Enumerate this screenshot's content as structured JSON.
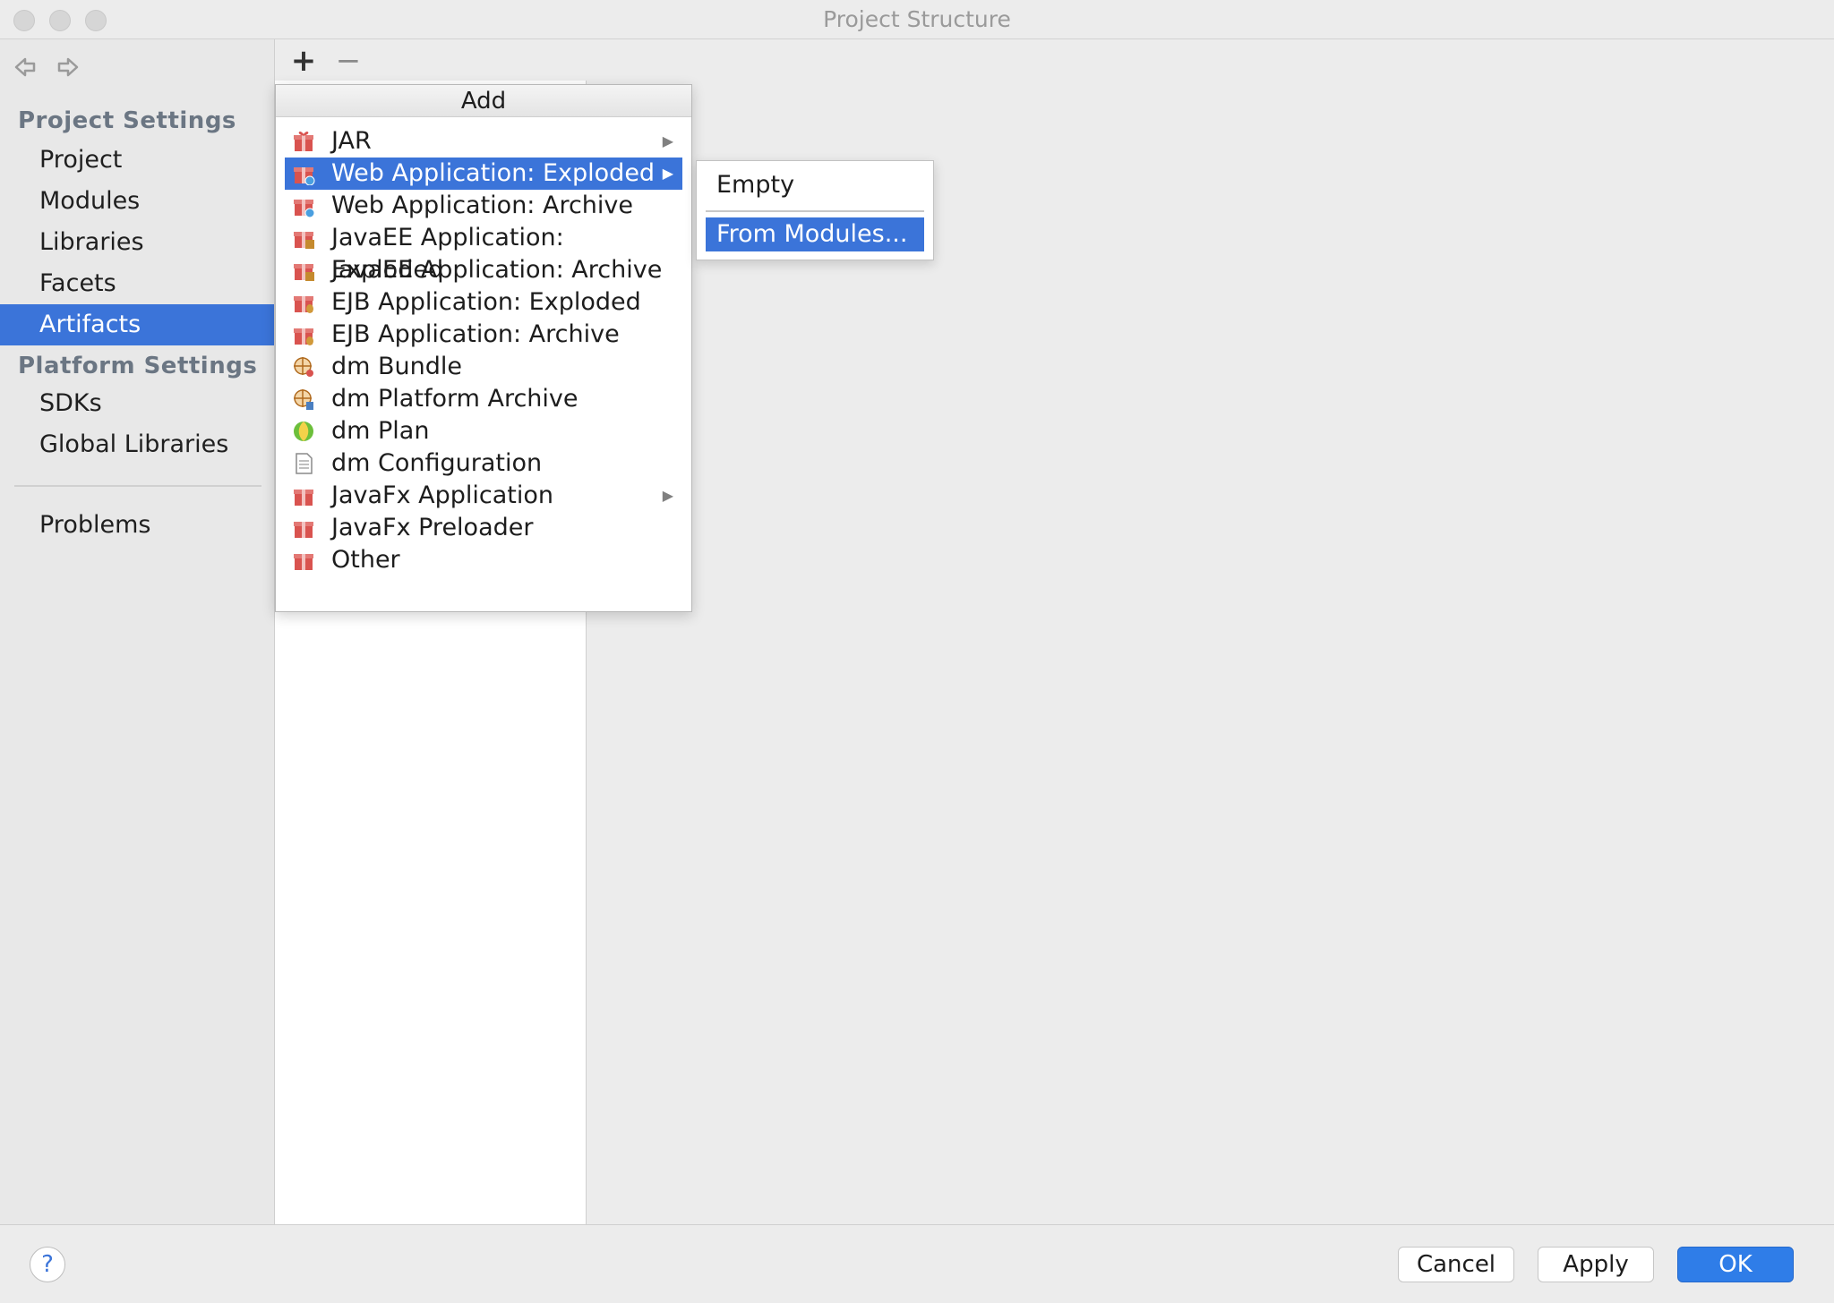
{
  "window": {
    "title": "Project Structure"
  },
  "sidebar": {
    "project_settings_header": "Project Settings",
    "platform_settings_header": "Platform Settings",
    "items": [
      {
        "label": "Project"
      },
      {
        "label": "Modules"
      },
      {
        "label": "Libraries"
      },
      {
        "label": "Facets"
      },
      {
        "label": "Artifacts",
        "selected": true
      },
      {
        "label": "SDKs"
      },
      {
        "label": "Global Libraries"
      },
      {
        "label": "Problems"
      }
    ]
  },
  "toolbar": {
    "add_label": "+",
    "remove_label": "−"
  },
  "popup": {
    "title": "Add",
    "items": [
      {
        "label": "JAR",
        "icon": "jar-gift-icon",
        "has_submenu": true
      },
      {
        "label": "Web Application: Exploded",
        "icon": "web-exploded-icon",
        "has_submenu": true,
        "selected": true
      },
      {
        "label": "Web Application: Archive",
        "icon": "web-archive-icon"
      },
      {
        "label": "JavaEE Application: Exploded",
        "icon": "javaee-exploded-icon"
      },
      {
        "label": "JavaEE Application: Archive",
        "icon": "javaee-archive-icon"
      },
      {
        "label": "EJB Application: Exploded",
        "icon": "ejb-exploded-icon"
      },
      {
        "label": "EJB Application: Archive",
        "icon": "ejb-archive-icon"
      },
      {
        "label": "dm Bundle",
        "icon": "dm-bundle-icon"
      },
      {
        "label": "dm Platform Archive",
        "icon": "dm-platform-archive-icon"
      },
      {
        "label": "dm Plan",
        "icon": "dm-plan-icon"
      },
      {
        "label": "dm Configuration",
        "icon": "document-icon"
      },
      {
        "label": "JavaFx Application",
        "icon": "javafx-app-icon",
        "has_submenu": true
      },
      {
        "label": "JavaFx Preloader",
        "icon": "javafx-preloader-icon"
      },
      {
        "label": "Other",
        "icon": "other-gift-icon"
      }
    ]
  },
  "submenu": {
    "items": [
      {
        "label": "Empty"
      },
      {
        "label": "From Modules...",
        "selected": true
      }
    ]
  },
  "buttons": {
    "help": "?",
    "cancel": "Cancel",
    "apply": "Apply",
    "ok": "OK"
  },
  "colors": {
    "selection": "#3b74d9",
    "ok_button": "#2f7de8",
    "group_header": "#6b7683"
  }
}
